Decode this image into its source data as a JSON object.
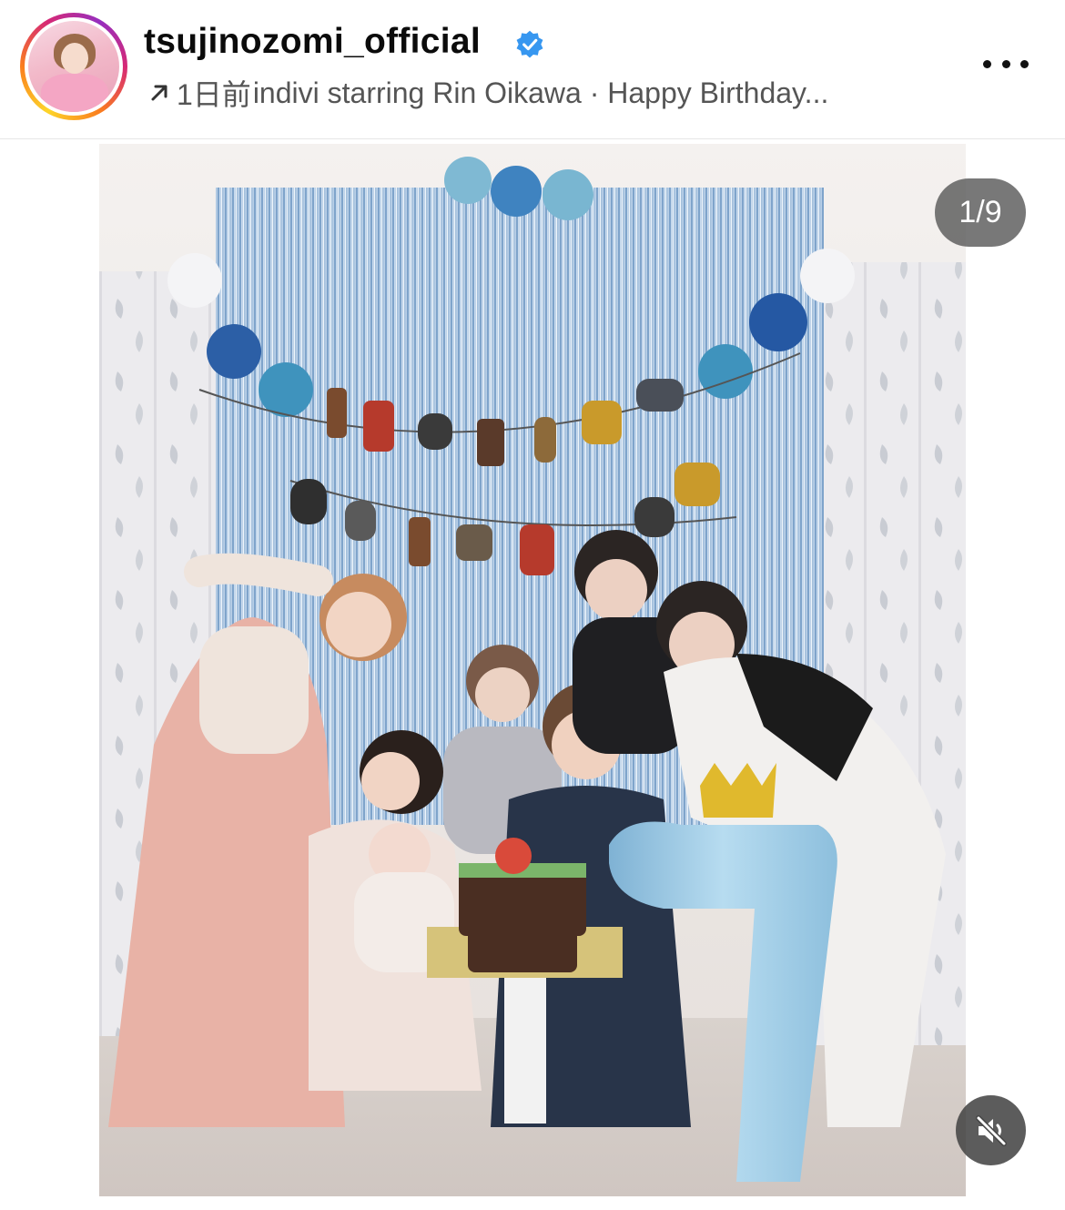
{
  "header": {
    "username": "tsujinozomi_official",
    "timestamp": "1日前",
    "audio_credit": "indivi starring Rin Oikawa · Happy Birthday..."
  },
  "carousel": {
    "counter": "1/9"
  },
  "icons": {
    "avatar": "profile-avatar",
    "verified": "verified-badge-icon",
    "audio": "arrow-up-right-icon",
    "more": "more-options-icon",
    "mute": "speaker-muted-icon"
  },
  "colors": {
    "verified_blue": "#3797f0",
    "counter_bg": "#5a5a5a",
    "mute_bg": "#464646"
  }
}
